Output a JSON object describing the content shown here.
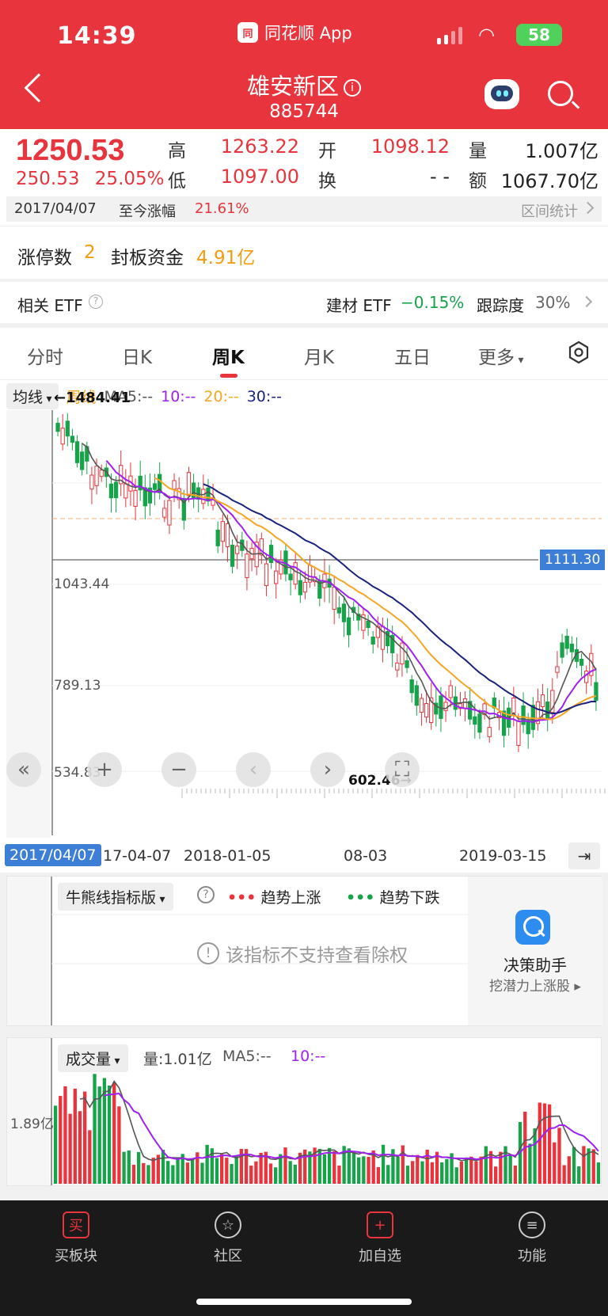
{
  "status": {
    "time": "14:39",
    "battery": "58"
  },
  "app": {
    "badge": "同花顺 App",
    "logo": "同"
  },
  "header": {
    "title": "雄安新区",
    "code": "885744"
  },
  "quote": {
    "price": "1250.53",
    "change": "250.53",
    "change_pct": "25.05%",
    "high_label": "高",
    "high": "1263.22",
    "low_label": "低",
    "low": "1097.00",
    "open_label": "开",
    "open": "1098.12",
    "turnover_label": "换",
    "turnover": "- -",
    "vol_label": "量",
    "vol": "1.007亿",
    "amount_label": "额",
    "amount": "1067.70亿"
  },
  "period": {
    "date": "2017/04/07",
    "label": "至今涨幅",
    "value": "21.61%",
    "stats": "区间统计"
  },
  "limit": {
    "label": "涨停数",
    "count": "2",
    "fund_label": "封板资金",
    "fund": "4.91亿"
  },
  "etf": {
    "label": "相关 ETF",
    "name": "建材 ETF",
    "change": "−0.15%",
    "track_label": "跟踪度",
    "track": "30%"
  },
  "tabs": [
    "分时",
    "日K",
    "周K",
    "月K",
    "五日",
    "更多"
  ],
  "ma": {
    "selector": "均线",
    "period": "周线",
    "ma5": "MA5:--",
    "ma10": "10:--",
    "ma20": "20:--",
    "ma30": "30:--"
  },
  "axis": {
    "top": "1484.41",
    "mid1": "1043.44",
    "mid2": "789.13",
    "bottom": "534.83",
    "low_mark": "602.46→",
    "high_mark": "←1484.41",
    "cursor": "1111.30"
  },
  "dates": {
    "selected": "2017/04/07",
    "d1": "17-04-07",
    "d2": "2018-01-05",
    "d3": "08-03",
    "d4": "2019-03-15"
  },
  "indicator": {
    "selector": "牛熊线指标版",
    "up_label": "趋势上涨",
    "down_label": "趋势下跌",
    "notice": "该指标不支持查看除权",
    "assistant_title": "决策助手",
    "assistant_sub": "挖潜力上涨股 ▸"
  },
  "volume": {
    "selector": "成交量",
    "vol": "量:1.01亿",
    "ma5": "MA5:--",
    "ma10": "10:--",
    "axis": "1.89亿"
  },
  "nav": [
    "买板块",
    "社区",
    "加自选",
    "功能"
  ],
  "nav_icons": [
    "买",
    "☆",
    "+",
    "≡"
  ],
  "colors": {
    "up": "#e8343d",
    "down": "#17a34a",
    "ma5": "#555555",
    "ma10": "#a020f0",
    "ma20": "#f5a623",
    "ma30": "#1a237e",
    "header": "#e8343d"
  }
}
